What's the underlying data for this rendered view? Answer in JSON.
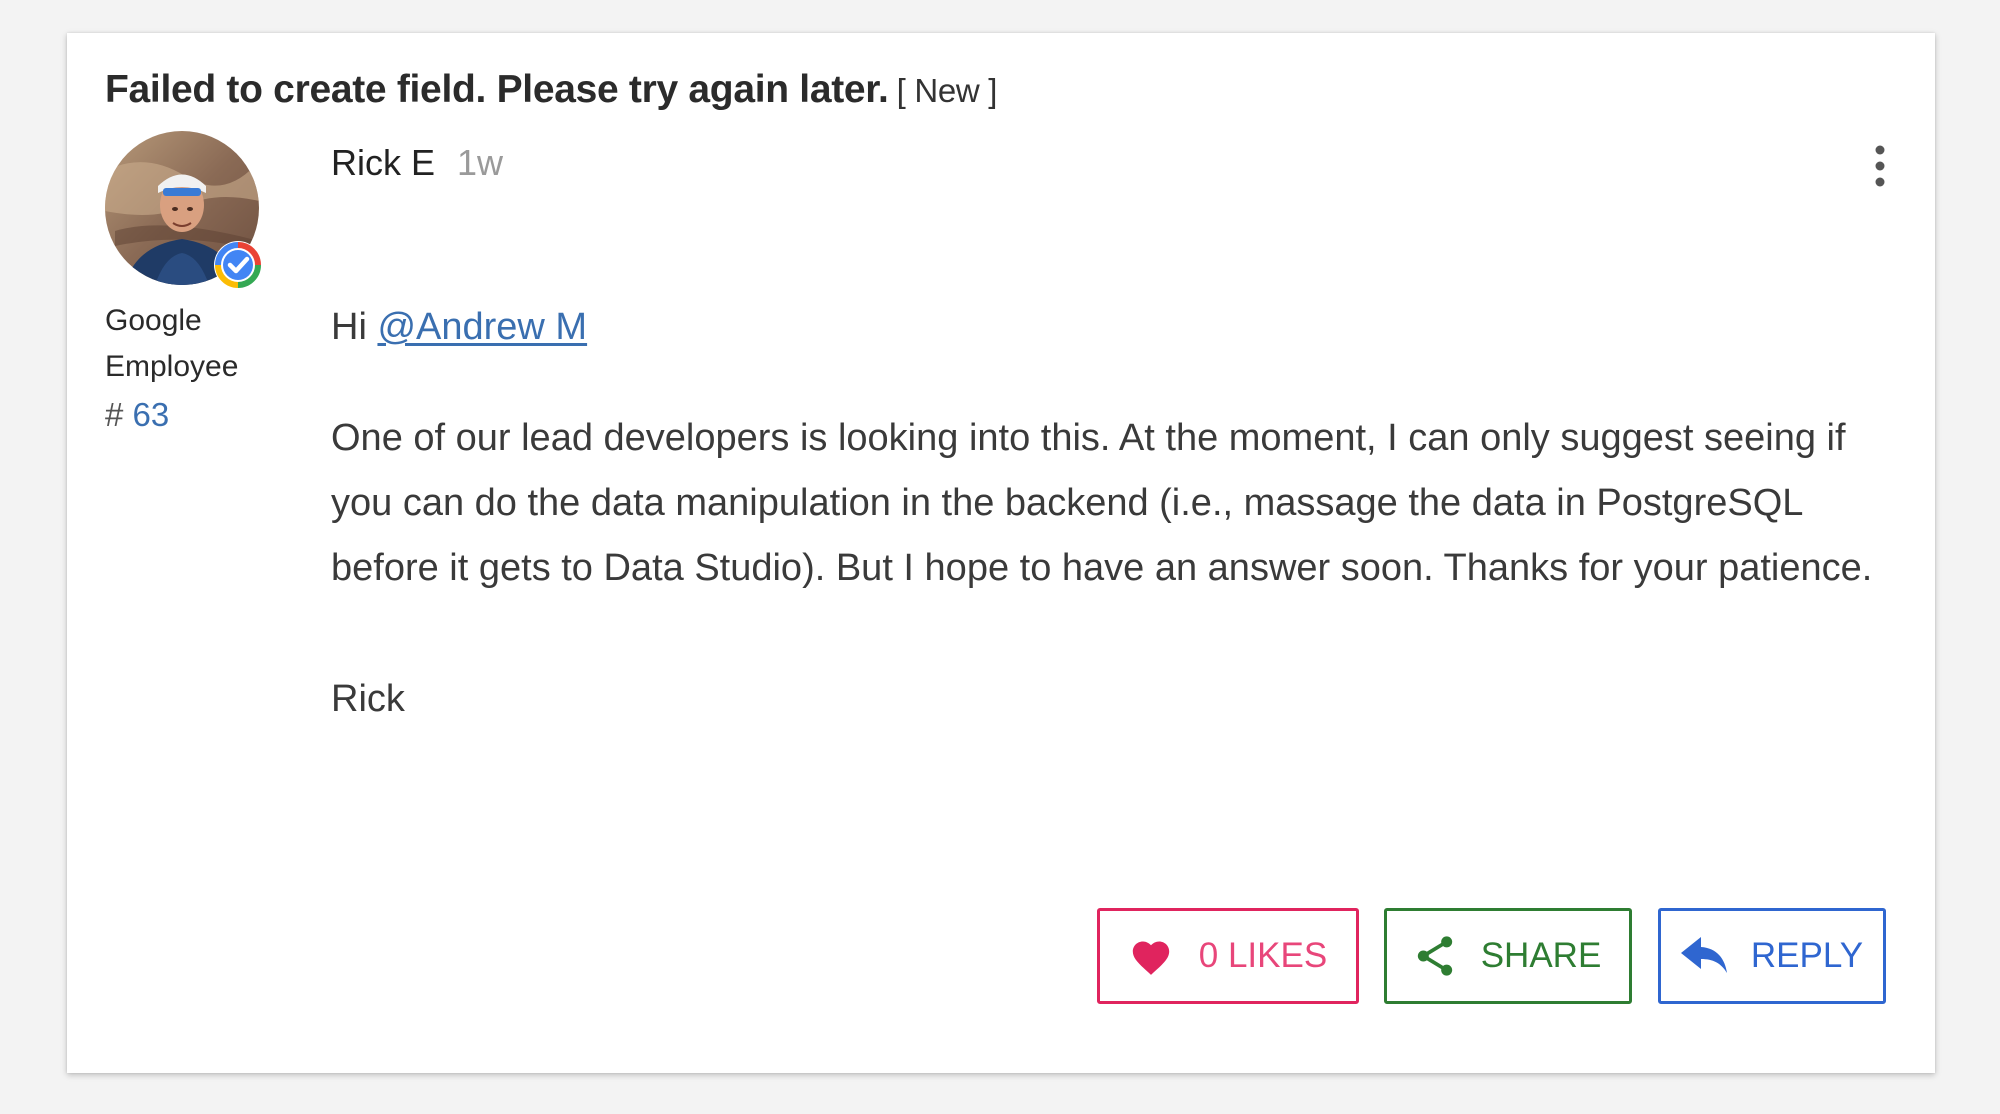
{
  "post": {
    "title": "Failed to create field. Please try again later.",
    "status_badge": "[ New ]",
    "author": {
      "name": "Rick E",
      "time_ago": "1w",
      "rank_line1": "Google",
      "rank_line2": "Employee",
      "post_count_prefix": "#",
      "post_count": "63",
      "avatar_icon": "user-avatar-photo",
      "badge_icon": "verified-check-icon"
    },
    "body": {
      "greeting_prefix": "Hi",
      "mention": "@Andrew M",
      "paragraph": "One of our lead developers is looking into this. At the moment, I can only suggest seeing if you can do the data manipulation in the backend (i.e., massage the data in PostgreSQL before it gets to Data Studio). But I hope to have an answer soon. Thanks for your patience.",
      "signature": "Rick"
    },
    "menu_icon": "more-vert-icon"
  },
  "actions": {
    "like": {
      "label": "0 LIKES",
      "icon": "heart-icon",
      "color": "#e0245e"
    },
    "share": {
      "label": "SHARE",
      "icon": "share-icon",
      "color": "#2e7d32"
    },
    "reply": {
      "label": "REPLY",
      "icon": "reply-arrow-icon",
      "color": "#2f66d0"
    }
  },
  "colors": {
    "link": "#3a6fb0",
    "background": "#f3f3f3",
    "card": "#ffffff"
  }
}
